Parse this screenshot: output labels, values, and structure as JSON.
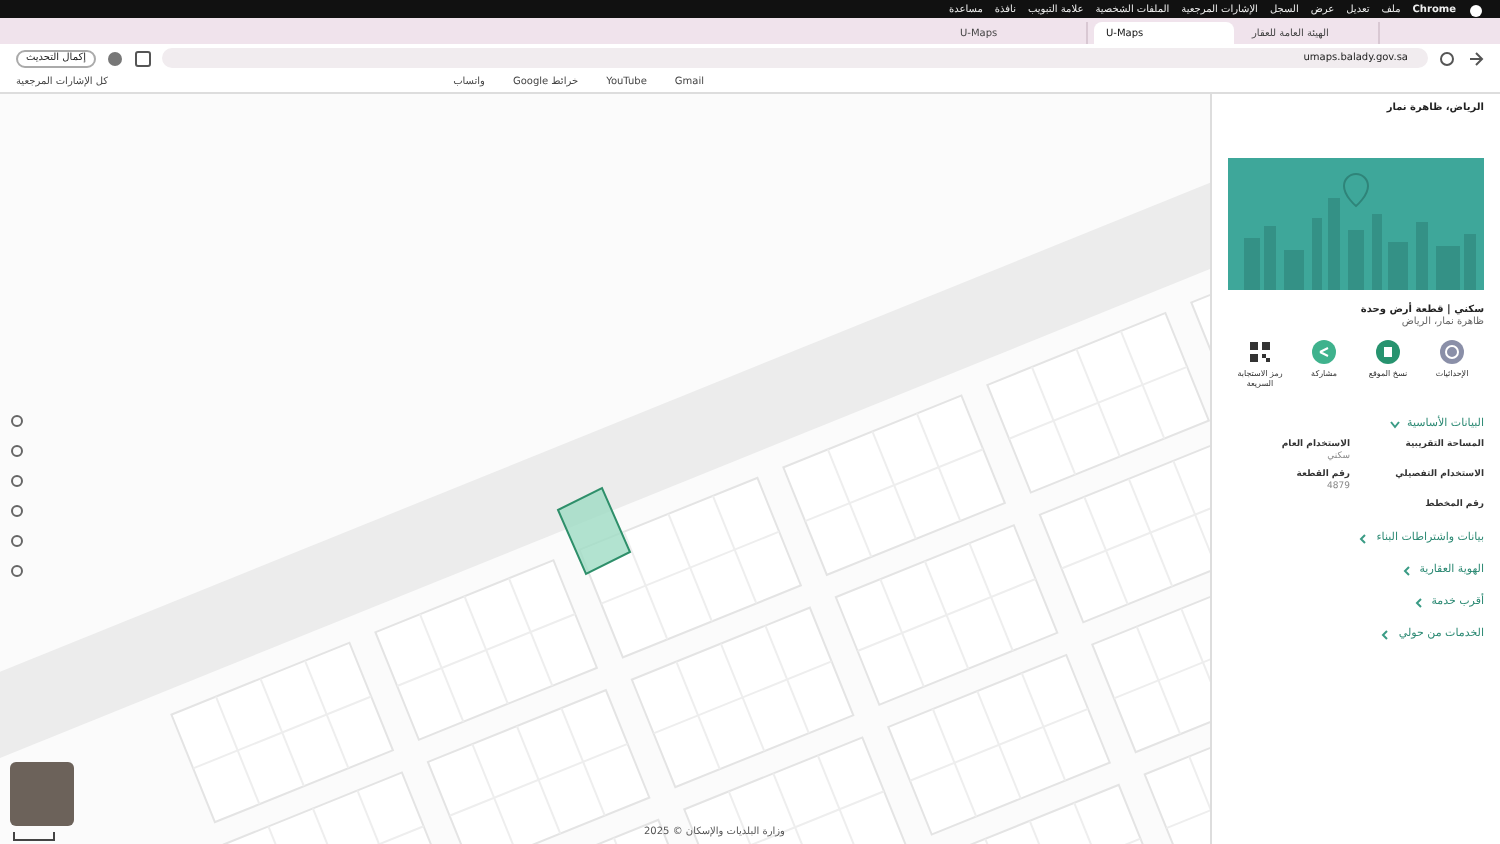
{
  "menu_bar": {
    "app": "Chrome",
    "items": [
      "ملف",
      "تعديل",
      "عرض",
      "السجل",
      "الإشارات المرجعية",
      "الملفات الشخصية",
      "علامة التبويب",
      "نافذة",
      "مساعدة"
    ]
  },
  "tabs": [
    {
      "label": "الهيئة العامة للعقار",
      "selected": false
    },
    {
      "label": "U-Maps",
      "selected": true
    },
    {
      "label": "U-Maps",
      "selected": false
    }
  ],
  "toolbar": {
    "address": "umaps.balady.gov.sa",
    "update_button": "إكمال التحديث"
  },
  "bookmarks": {
    "items": [
      "Gmail",
      "YouTube",
      "خرائط Google",
      "واتساب"
    ],
    "all_bookmarks": "كل الإشارات المرجعية"
  },
  "panel": {
    "title": "الرياض، ظاهرة نمار",
    "card_title": "سكني | قطعة أرض وحدة",
    "card_subtitle": "ظاهرة نمار، الرياض",
    "actions": [
      {
        "label": "الإحداثيات",
        "kind": "pin"
      },
      {
        "label": "نسخ الموقع",
        "kind": "copy"
      },
      {
        "label": "مشاركة",
        "kind": "share"
      },
      {
        "label": "رمز الاستجابة السريعة",
        "kind": "qr"
      }
    ],
    "sections": [
      {
        "title": "البيانات الأساسية",
        "expanded": true,
        "fields": [
          {
            "label": "المساحة التقريبية"
          },
          {
            "label": "الاستخدام العام",
            "value": "سكني"
          },
          {
            "label": "الاستخدام التفصيلي"
          },
          {
            "label": "رقم القطعة",
            "value": "4879"
          },
          {
            "label": "رقم المخطط"
          }
        ]
      },
      {
        "title": "بيانات واشتراطات البناء",
        "expanded": false
      },
      {
        "title": "الهوية العقارية",
        "expanded": false
      },
      {
        "title": "أقرب خدمة",
        "expanded": false
      },
      {
        "title": "الخدمات من حولي",
        "expanded": false
      }
    ]
  },
  "map": {
    "attribution": "وزارة البلديات والإسكان © 2025"
  }
}
